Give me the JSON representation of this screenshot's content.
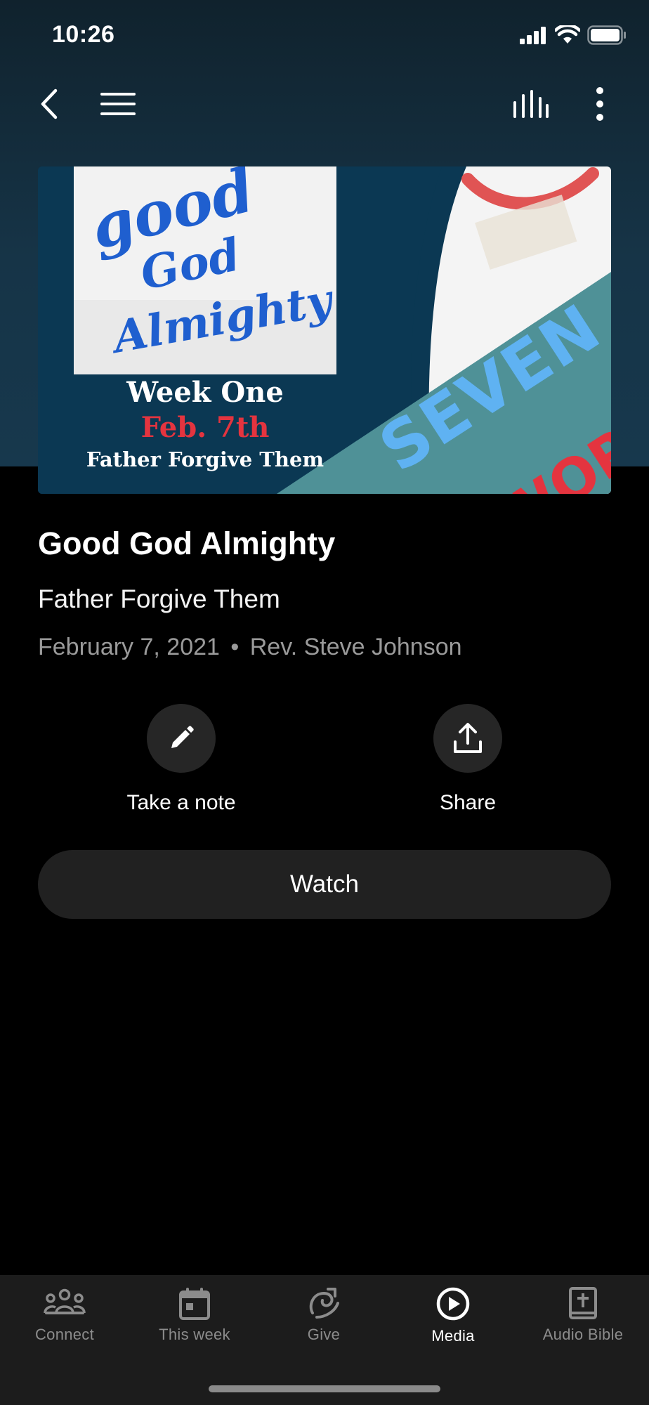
{
  "status_bar": {
    "time": "10:26"
  },
  "artwork": {
    "script_text": [
      "good",
      "God",
      "Almighty"
    ],
    "week_label": "Week One",
    "date_label": "Feb. 7th",
    "sermon_label": "Father Forgive Them",
    "banner_text": [
      "SEVEN",
      "WORDS"
    ]
  },
  "sermon": {
    "title": "Good God Almighty",
    "subtitle": "Father Forgive Them",
    "date": "February 7, 2021",
    "separator": "•",
    "speaker": "Rev. Steve Johnson"
  },
  "actions": {
    "note_label": "Take a note",
    "share_label": "Share",
    "watch_label": "Watch"
  },
  "tabs": [
    {
      "label": "Connect",
      "icon": "people-icon",
      "active": false
    },
    {
      "label": "This week",
      "icon": "calendar-icon",
      "active": false
    },
    {
      "label": "Give",
      "icon": "give-icon",
      "active": false
    },
    {
      "label": "Media",
      "icon": "play-circle-icon",
      "active": true
    },
    {
      "label": "Audio Bible",
      "icon": "bible-icon",
      "active": false
    }
  ],
  "colors": {
    "accent_red": "#e4343f",
    "script_blue": "#1f5fcf",
    "teal": "#4f9197",
    "banner_blue": "#5fb2f2"
  }
}
